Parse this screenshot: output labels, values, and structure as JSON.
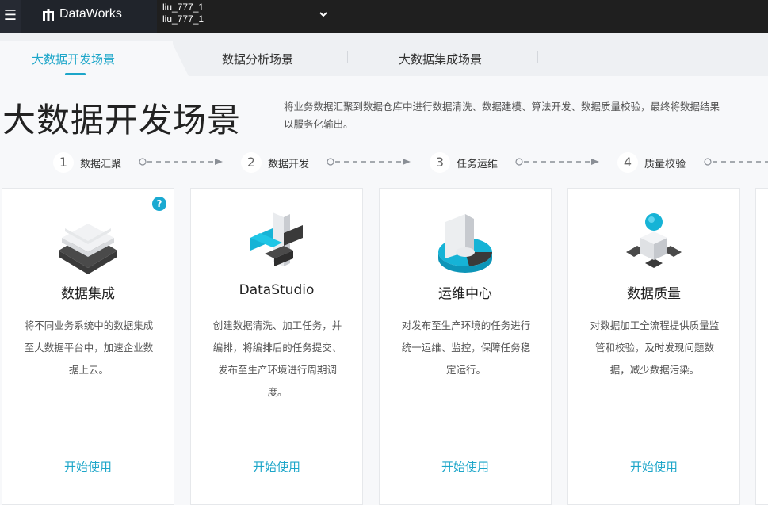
{
  "topbar": {
    "menu_glyph": "☰",
    "brand": "DataWorks",
    "account_line1": "liu_777_1",
    "account_line2": "liu_777_1"
  },
  "tabs": [
    {
      "label": "大数据开发场景",
      "active": true
    },
    {
      "label": "数据分析场景",
      "active": false
    },
    {
      "label": "大数据集成场景",
      "active": false
    }
  ],
  "hero": {
    "title": "大数据开发场景",
    "description": "将业务数据汇聚到数据仓库中进行数据清洗、数据建模、算法开发、数据质量校验，最终将数据结果以服务化输出。"
  },
  "steps": [
    {
      "num": "1",
      "label": "数据汇聚"
    },
    {
      "num": "2",
      "label": "数据开发"
    },
    {
      "num": "3",
      "label": "任务运维"
    },
    {
      "num": "4",
      "label": "质量校验"
    }
  ],
  "cards": [
    {
      "name": "数据集成",
      "text": "将不同业务系统中的数据集成至大数据平台中，加速企业数据上云。",
      "action": "开始使用",
      "help": "?"
    },
    {
      "name": "DataStudio",
      "text": "创建数据清洗、加工任务，并编排，将编排后的任务提交、发布至生产环境进行周期调度。",
      "action": "开始使用"
    },
    {
      "name": "运维中心",
      "text": "对发布至生产环境的任务进行统一运维、监控，保障任务稳定运行。",
      "action": "开始使用"
    },
    {
      "name": "数据质量",
      "text": "对数据加工全流程提供质量监管和校验，及时发现问题数据，减少数据污染。",
      "action": "开始使用"
    }
  ],
  "colors": {
    "accent": "#1da6c9",
    "topbar": "#1f1f1f",
    "dark_icon": "#3a3a3a",
    "cyan_icon": "#16b3d6"
  }
}
